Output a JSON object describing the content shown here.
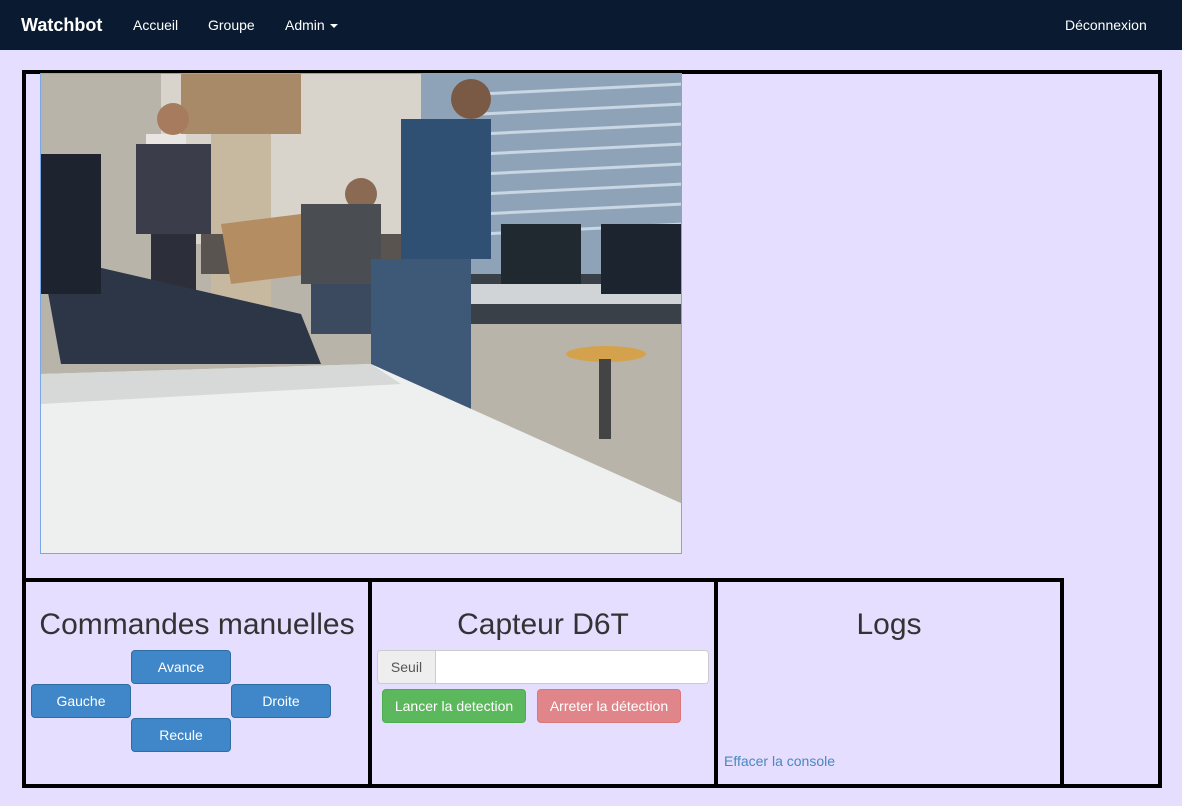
{
  "navbar": {
    "brand": "Watchbot",
    "links": [
      "Accueil",
      "Groupe",
      "Admin"
    ],
    "logout": "Déconnexion"
  },
  "camera": {
    "alt": "Flux vidéo de la caméra du robot"
  },
  "manual": {
    "title": "Commandes manuelles",
    "forward": "Avance",
    "left": "Gauche",
    "right": "Droite",
    "backward": "Recule"
  },
  "sensor": {
    "title": "Capteur D6T",
    "threshold_label": "Seuil",
    "threshold_value": "",
    "start": "Lancer la detection",
    "stop": "Arreter la détection"
  },
  "logs": {
    "title": "Logs",
    "clear": "Effacer la console"
  },
  "colors": {
    "background": "#e5deff",
    "navbar": "#0a1a30",
    "primary": "#3f87c8",
    "success": "#5cb85c",
    "danger": "#e0868a"
  }
}
